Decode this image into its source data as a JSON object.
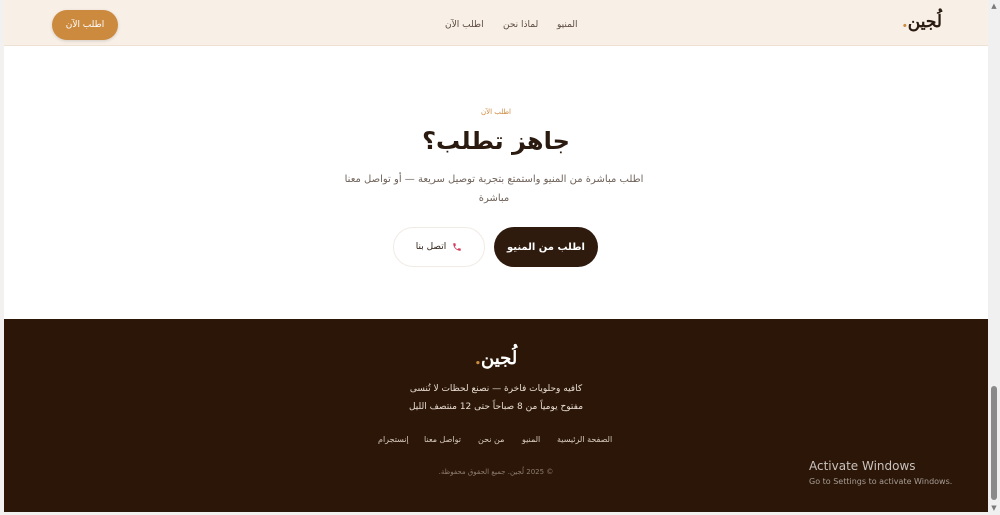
{
  "header": {
    "logo_text": "لُجين",
    "logo_dot": ".",
    "nav": [
      "المنيو",
      "لماذا نحن",
      "اطلب الآن"
    ],
    "cta_label": "اطلب الآن"
  },
  "cta_section": {
    "eyebrow": "اطلب الآن",
    "headline": "جاهز تطلب؟",
    "description": "اطلب مباشرة من المنيو واستمتع بتجربة توصيل سريعة — أو تواصل معنا مباشرة",
    "primary_button": "اطلب من المنيو",
    "secondary_button": "اتصل بنا",
    "secondary_icon": "phone-icon"
  },
  "footer": {
    "logo_text": "لُجين",
    "logo_dot": ".",
    "tagline": "كافيه وحلويات فاخرة — نصنع لحظات لا تُنسى",
    "hours": "مفتوح يومياً من 8 صباحاً حتى 12 منتصف الليل",
    "links": [
      "الصفحة الرئيسية",
      "المنيو",
      "من نحن",
      "تواصل معنا",
      "إنستجرام"
    ],
    "copyright": "© 2025 لُجين. جميع الحقوق محفوظة."
  },
  "watermark": {
    "title": "Activate Windows",
    "subtitle": "Go to Settings to activate Windows."
  },
  "colors": {
    "accent": "#cc8a3f",
    "dark_brown": "#2b1608",
    "header_bg": "#f8efe6"
  }
}
